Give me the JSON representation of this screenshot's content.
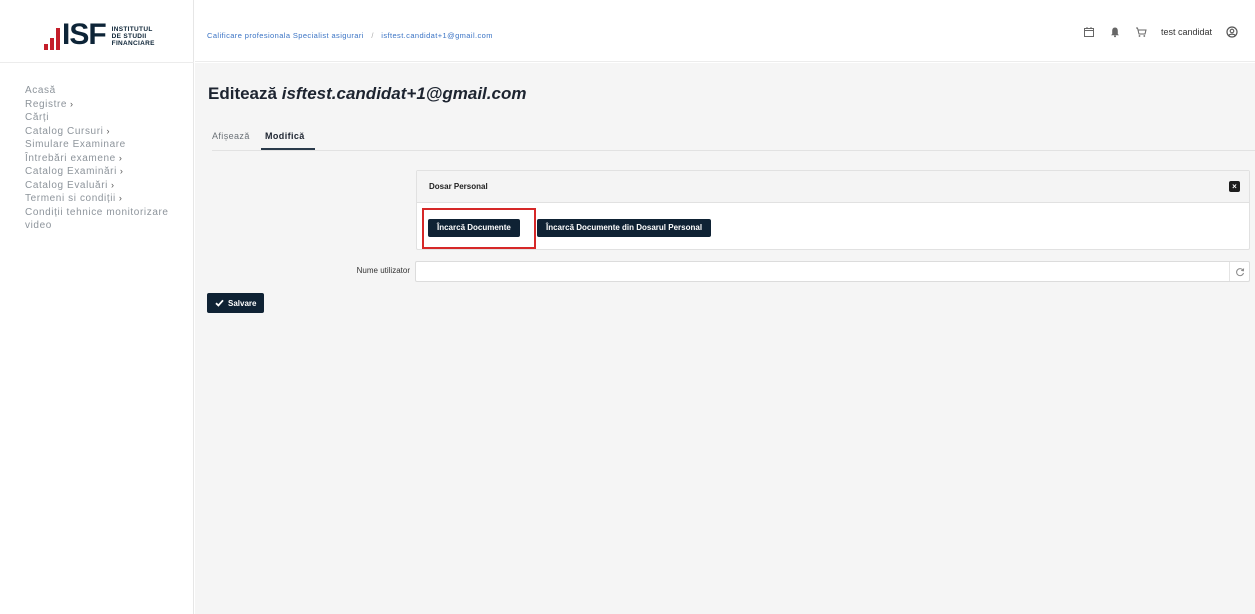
{
  "brand": {
    "logo_text": "ISF",
    "logo_line1": "INSTITUTUL",
    "logo_line2": "DE STUDII",
    "logo_line3": "FINANCIARE",
    "accent_color": "#c41e2a",
    "primary_color": "#0f2234"
  },
  "sidebar": {
    "items": [
      {
        "label": "Acasă",
        "has_chevron": false
      },
      {
        "label": "Registre",
        "has_chevron": true
      },
      {
        "label": "Cărți",
        "has_chevron": false
      },
      {
        "label": "Catalog Cursuri",
        "has_chevron": true
      },
      {
        "label": "Simulare Examinare",
        "has_chevron": false
      },
      {
        "label": "Întrebări examene",
        "has_chevron": true
      },
      {
        "label": "Catalog Examinări",
        "has_chevron": true
      },
      {
        "label": "Catalog Evaluări",
        "has_chevron": true
      },
      {
        "label": "Termeni si condiții",
        "has_chevron": true
      },
      {
        "label": "Condiții tehnice monitorizare video",
        "has_chevron": false
      }
    ],
    "chevron_glyph": "›"
  },
  "topbar": {
    "breadcrumb": [
      "Calificare profesionala Specialist asigurari",
      "isftest.candidat+1@gmail.com"
    ],
    "breadcrumb_separator": "/",
    "icons": [
      "calendar-icon",
      "bell-icon",
      "cart-icon"
    ],
    "user_name": "test candidat",
    "user_icon": "user-circle-icon"
  },
  "page": {
    "title_prefix": "Editează",
    "title_email": "isftest.candidat+1@gmail.com",
    "tabs": [
      {
        "label": "Afișează",
        "active": false
      },
      {
        "label": "Modifică",
        "active": true
      }
    ]
  },
  "dossier_panel": {
    "title": "Dosar Personal",
    "upload_button": "Încarcă Documente",
    "upload_from_dossier_button": "Încarcă Documente din Dosarul Personal"
  },
  "form": {
    "username_label": "Nume utilizator",
    "username_value": "",
    "save_button": "Salvare"
  }
}
